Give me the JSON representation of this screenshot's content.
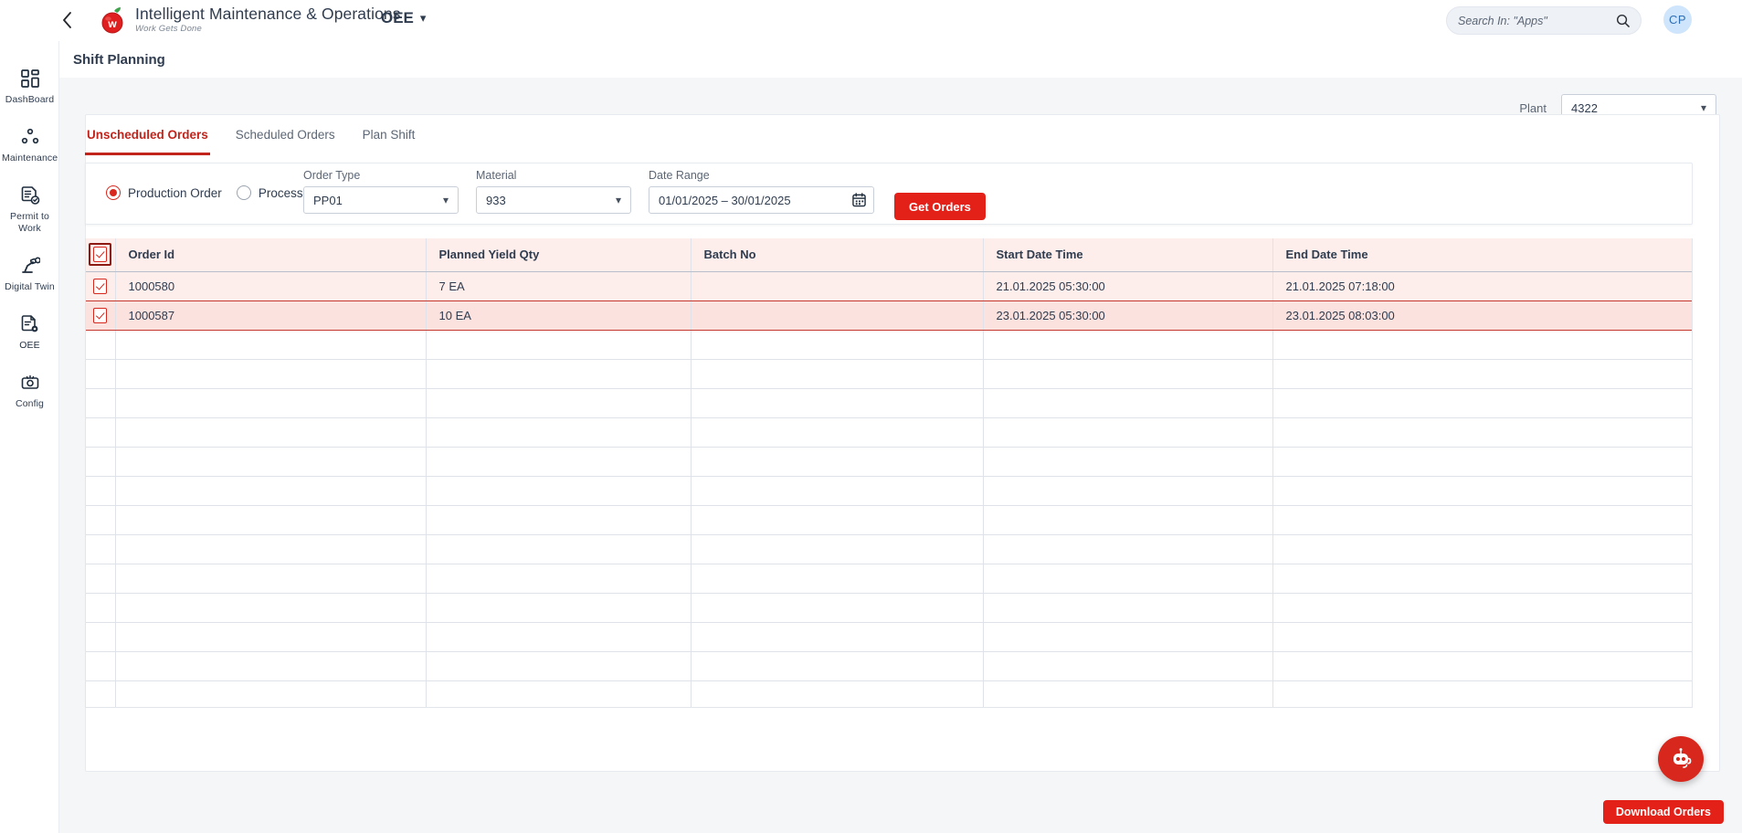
{
  "header": {
    "back_icon": "chevron-left-icon",
    "logo_icon": "apple-logo-icon",
    "brand_title": "Intelligent Maintenance & Operations",
    "brand_subtitle": "Work Gets Done",
    "module": "OEE",
    "module_chevron": "chevron-down-icon",
    "search_placeholder": "Search In: \"Apps\"",
    "search_value": "",
    "search_icon": "search-icon",
    "avatar_initials": "CP"
  },
  "sidebar": {
    "items": [
      {
        "label": "DashBoard",
        "icon": "dashboard-grid-icon"
      },
      {
        "label": "Maintenance",
        "icon": "maintenance-nodes-icon"
      },
      {
        "label": "Permit to Work",
        "icon": "permit-document-check-icon"
      },
      {
        "label": "Digital Twin",
        "icon": "robot-arm-icon"
      },
      {
        "label": "OEE",
        "icon": "document-gear-icon"
      },
      {
        "label": "Config",
        "icon": "config-gear-box-icon"
      }
    ],
    "active_index": 4
  },
  "page": {
    "title": "Shift Planning"
  },
  "plant": {
    "label": "Plant",
    "value": "4322",
    "chevron": "chevron-down-icon"
  },
  "tabs": [
    {
      "label": "Unscheduled Orders",
      "active": true
    },
    {
      "label": "Scheduled Orders",
      "active": false
    },
    {
      "label": "Plan Shift",
      "active": false
    }
  ],
  "filters": {
    "order_kind": {
      "options": [
        {
          "label": "Production Order",
          "selected": true
        },
        {
          "label": "Process Order",
          "selected": false
        }
      ]
    },
    "order_type": {
      "label": "Order Type",
      "value": "PP01",
      "chevron": "chevron-down-icon"
    },
    "material": {
      "label": "Material",
      "value": "933",
      "chevron": "chevron-down-icon"
    },
    "date_range": {
      "label": "Date Range",
      "value": "01/01/2025 – 30/01/2025",
      "icon": "calendar-icon"
    },
    "get_orders_label": "Get Orders"
  },
  "table": {
    "select_all_checked": true,
    "columns": [
      "Order Id",
      "Planned Yield Qty",
      "Batch No",
      "Start Date Time",
      "End Date Time"
    ],
    "rows": [
      {
        "checked": true,
        "order_id": "1000580",
        "planned_yield_qty": "7 EA",
        "batch_no": "",
        "start_date_time": "21.01.2025 05:30:00",
        "end_date_time": "21.01.2025 07:18:00"
      },
      {
        "checked": true,
        "order_id": "1000587",
        "planned_yield_qty": "10 EA",
        "batch_no": "",
        "start_date_time": "23.01.2025 05:30:00",
        "end_date_time": "23.01.2025 08:03:00"
      }
    ],
    "empty_row_count": 13
  },
  "footer": {
    "download_label": "Download Orders",
    "chat_icon": "chat-bot-headset-icon"
  },
  "colors": {
    "brand_red": "#e32119",
    "accent_red": "#c2241b",
    "row_highlight": "#fdeeeb",
    "header_text": "#2f3c4f"
  }
}
